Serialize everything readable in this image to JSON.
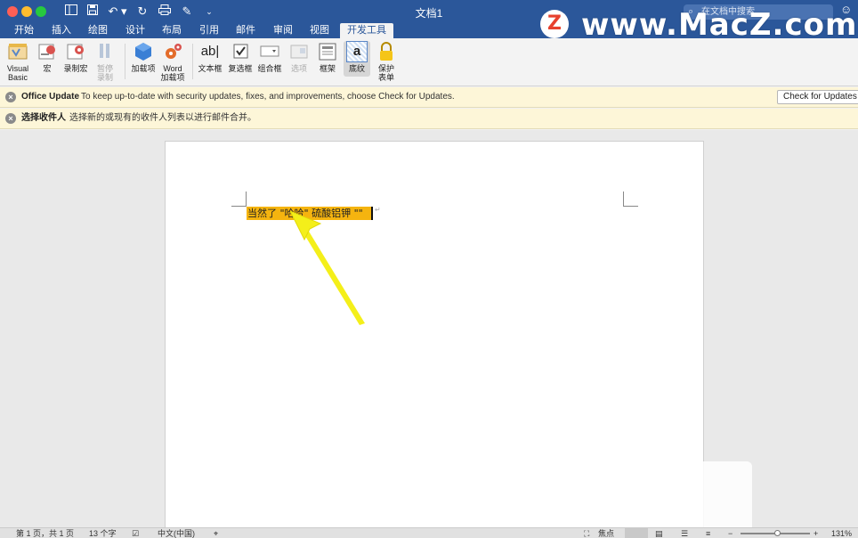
{
  "window": {
    "title": "文档1",
    "search_placeholder": "在文档中搜索"
  },
  "tabs": [
    "开始",
    "插入",
    "绘图",
    "设计",
    "布局",
    "引用",
    "邮件",
    "审阅",
    "视图",
    "开发工具"
  ],
  "active_tab": "开发工具",
  "ribbon": {
    "visual_basic": [
      "Visual",
      "Basic"
    ],
    "macro": "宏",
    "record_macro": "录制宏",
    "pause_record": [
      "暂停",
      "录制"
    ],
    "addins": "加载项",
    "word_addins": [
      "Word",
      "加载项"
    ],
    "text_box": "文本框",
    "text_box_icon_text": "ab|",
    "checkbox": "复选框",
    "combo_box": "组合框",
    "options": "选项",
    "frame": "框架",
    "shading": "底纹",
    "shading_icon_text": "a",
    "protect": [
      "保护",
      "表单"
    ]
  },
  "notices": {
    "update_title": "Office Update",
    "update_message": "To keep up-to-date with security updates, fixes, and improvements, choose Check for Updates.",
    "update_button": "Check for Updates",
    "recipients_title": "选择收件人",
    "recipients_message": "选择新的或现有的收件人列表以进行邮件合并。"
  },
  "document": {
    "highlighted_text": "当然了  \"哈哈\"  硫酸铝钾  \"\""
  },
  "statusbar": {
    "page": "第 1 页，共 1 页",
    "word_count": "13 个字",
    "language": "中文(中国)",
    "focus": "焦点",
    "zoom": "131%"
  },
  "watermark": {
    "logo_letter": "Z",
    "text": "www.MacZ.com"
  },
  "colors": {
    "titlebar": "#2b579a",
    "highlight": "#f5b40f",
    "arrow": "#f4ef1a",
    "notice_bg": "#fdf6d8"
  }
}
